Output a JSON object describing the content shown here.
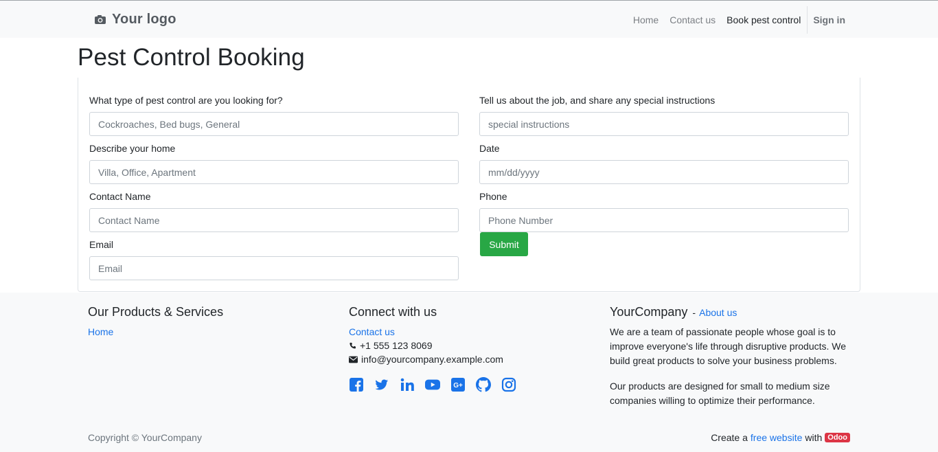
{
  "nav": {
    "logo_text": "Your logo",
    "items": [
      {
        "label": "Home"
      },
      {
        "label": "Contact us"
      },
      {
        "label": "Book pest control"
      }
    ],
    "signin_label": "Sign in"
  },
  "main": {
    "title": "Pest Control Booking",
    "fields": {
      "pest_type": {
        "label": "What type of pest control are you looking for?",
        "placeholder": "Cockroaches, Bed bugs, General"
      },
      "home": {
        "label": "Describe your home",
        "placeholder": "Villa, Office, Apartment"
      },
      "contact_name": {
        "label": "Contact Name",
        "placeholder": "Contact Name"
      },
      "email": {
        "label": "Email",
        "placeholder": "Email"
      },
      "instructions": {
        "label": "Tell us about the job, and share any special instructions",
        "placeholder": "special instructions"
      },
      "date": {
        "label": "Date",
        "placeholder": "mm/dd/yyyy"
      },
      "phone": {
        "label": "Phone",
        "placeholder": "Phone Number"
      }
    },
    "submit_label": "Submit"
  },
  "footer": {
    "products": {
      "heading": "Our Products & Services",
      "links": [
        "Home"
      ]
    },
    "connect": {
      "heading": "Connect with us",
      "contact_link": "Contact us",
      "phone": "+1 555 123 8069",
      "email": "info@yourcompany.example.com",
      "social_icons": [
        "facebook-icon",
        "twitter-icon",
        "linkedin-icon",
        "youtube-icon",
        "google-plus-icon",
        "github-icon",
        "instagram-icon"
      ]
    },
    "about": {
      "company": "YourCompany",
      "separator": "-",
      "about_link": "About us",
      "p1": "We are a team of passionate people whose goal is to improve everyone's life through disruptive products. We build great products to solve your business problems.",
      "p2": "Our products are designed for small to medium size companies willing to optimize their performance."
    },
    "copyright": "Copyright © YourCompany",
    "powered": {
      "prefix": "Create a",
      "link": "free website",
      "middle": "with",
      "badge": "Odoo"
    }
  },
  "colors": {
    "accent": "#1a73e8",
    "submit": "#28a745",
    "badge": "#dc3545",
    "navbar_bg": "#f8f9fa"
  }
}
